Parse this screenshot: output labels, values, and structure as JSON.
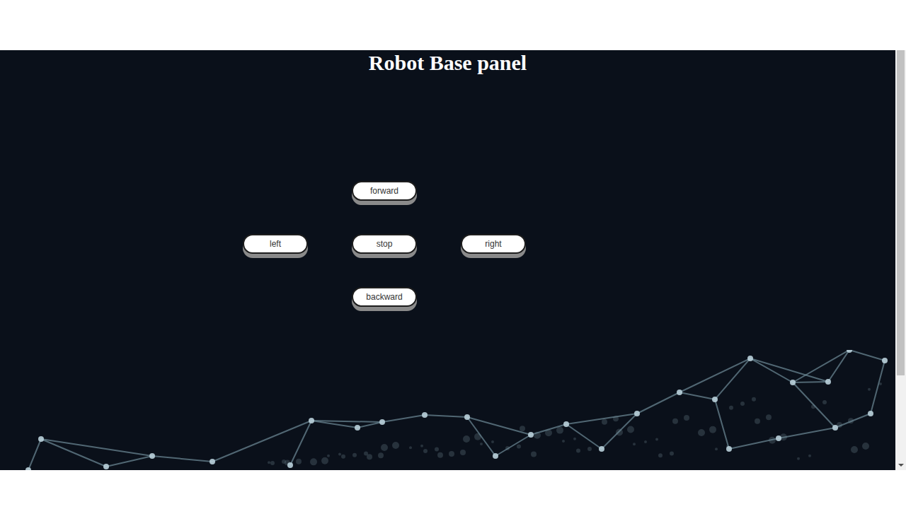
{
  "page": {
    "title": "Robot Base panel"
  },
  "buttons": [
    {
      "label": "forward"
    },
    {
      "label": "left"
    },
    {
      "label": "stop"
    },
    {
      "label": "right"
    },
    {
      "label": "backward"
    }
  ]
}
